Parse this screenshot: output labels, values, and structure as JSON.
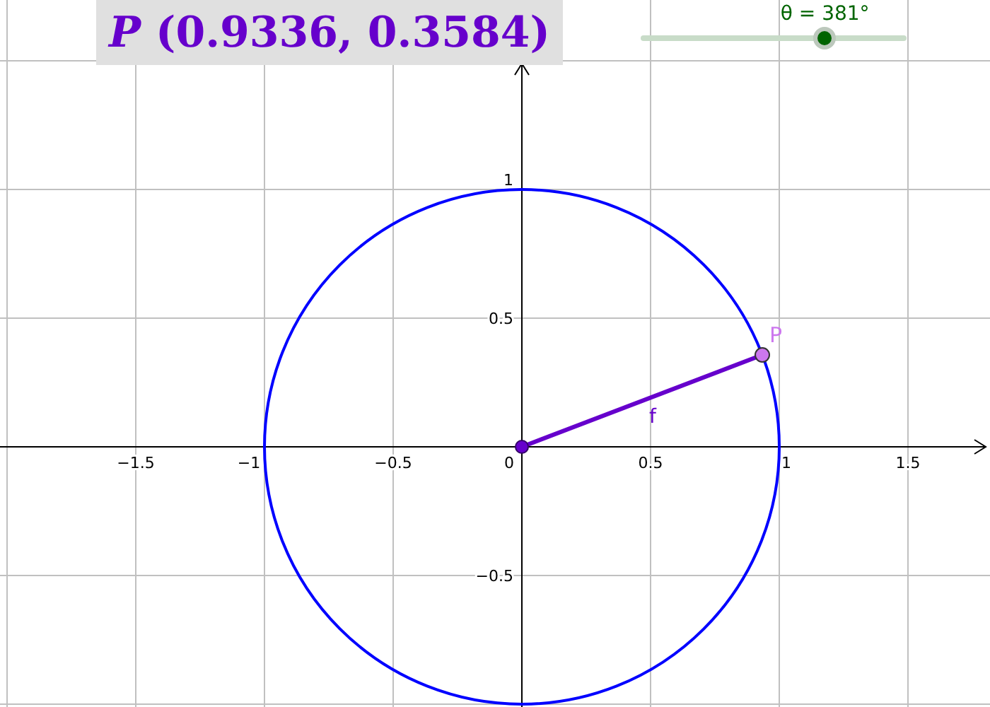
{
  "coordinate_label": "*P* (0.9336, 0.3584)",
  "slider": {
    "label": "θ = 381°",
    "level": 0.69
  },
  "x_ticks": [
    "−1.5",
    "−1",
    "−0.5",
    "0",
    "0.5",
    "1",
    "1.5"
  ],
  "y_ticks": [
    "1",
    "0.5",
    "−0.5"
  ],
  "point_labels": [
    "P",
    "f"
  ]
}
